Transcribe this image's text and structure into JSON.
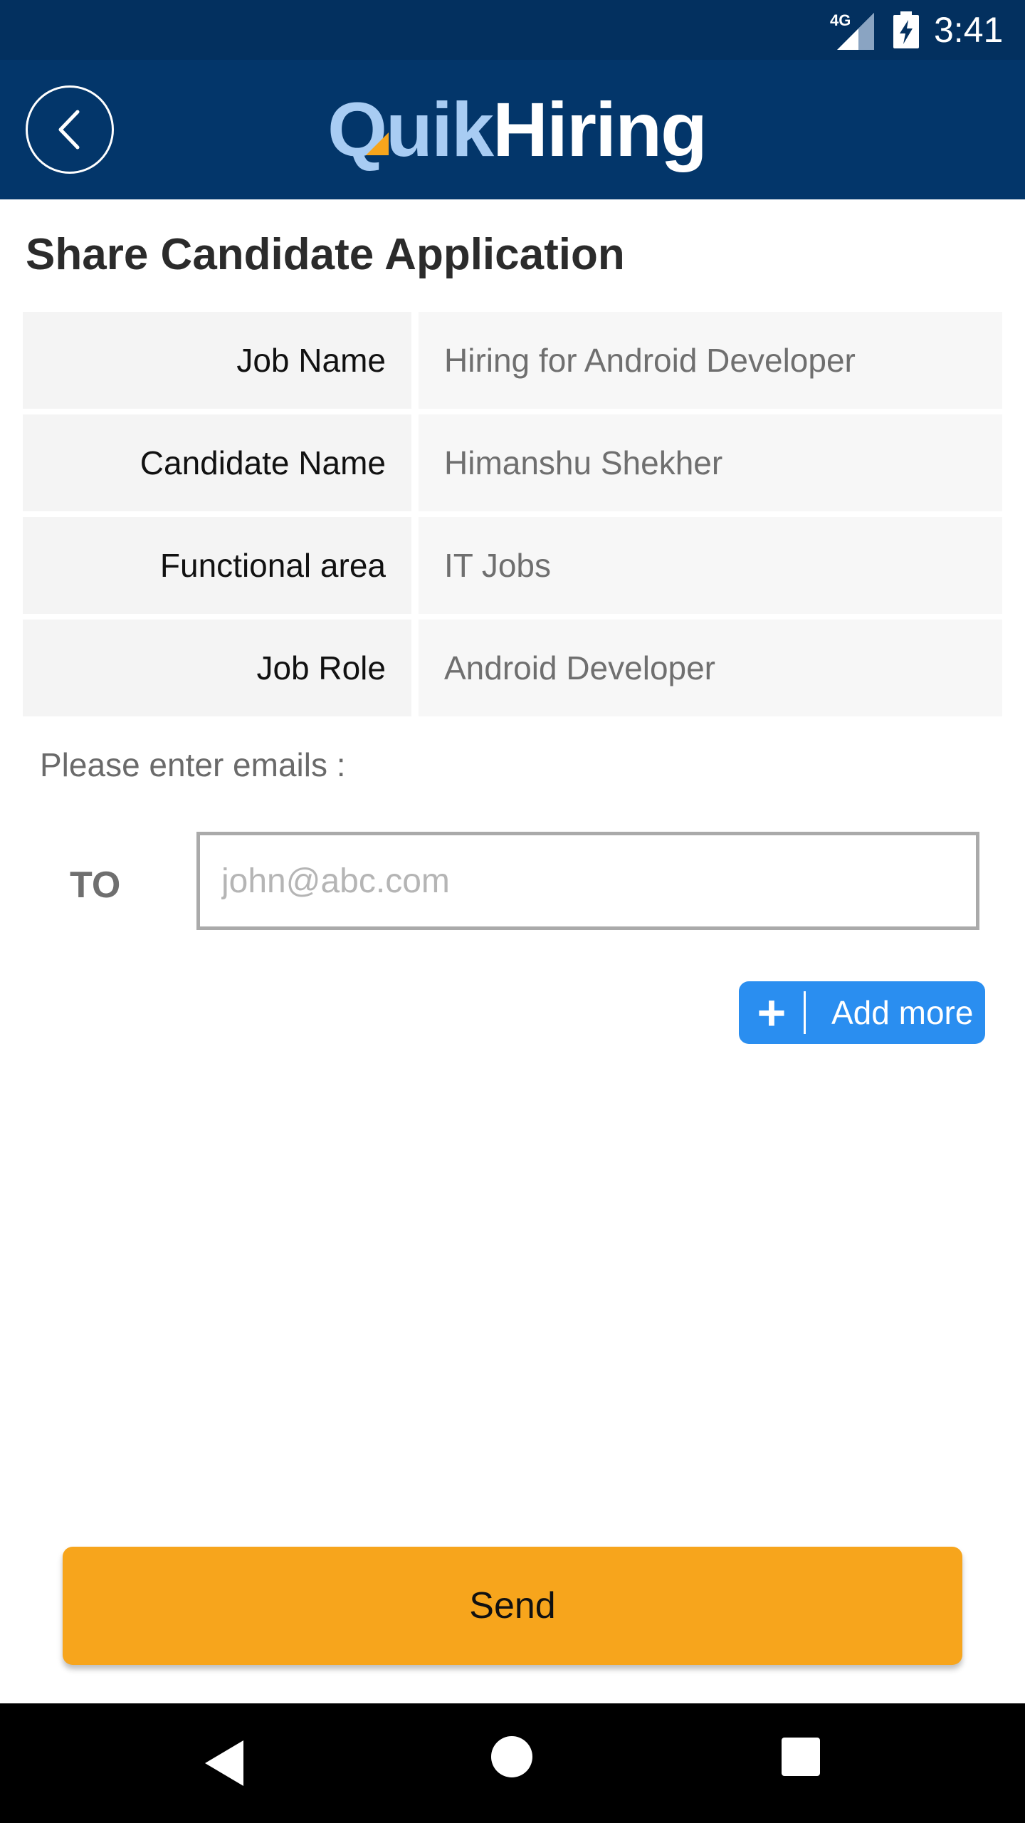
{
  "status_bar": {
    "network": "4G",
    "time": "3:41"
  },
  "app_bar": {
    "logo_quik": "Quik",
    "logo_hiring": "Hiring"
  },
  "page": {
    "title": "Share Candidate Application"
  },
  "details": [
    {
      "label": "Job Name",
      "value": "Hiring for Android Developer"
    },
    {
      "label": "Candidate Name",
      "value": "Himanshu Shekher"
    },
    {
      "label": "Functional area",
      "value": "IT Jobs"
    },
    {
      "label": "Job Role",
      "value": "Android Developer"
    }
  ],
  "email": {
    "prompt": "Please enter emails :",
    "to_label": "TO",
    "placeholder": "john@abc.com",
    "value": "",
    "add_more_label": "Add more"
  },
  "send_label": "Send",
  "colors": {
    "status_bar": "#03305f",
    "app_bar": "#03366a",
    "accent_blue": "#2a8ef0",
    "send_orange": "#f7a51c",
    "logo_light": "#a8ccf3"
  }
}
